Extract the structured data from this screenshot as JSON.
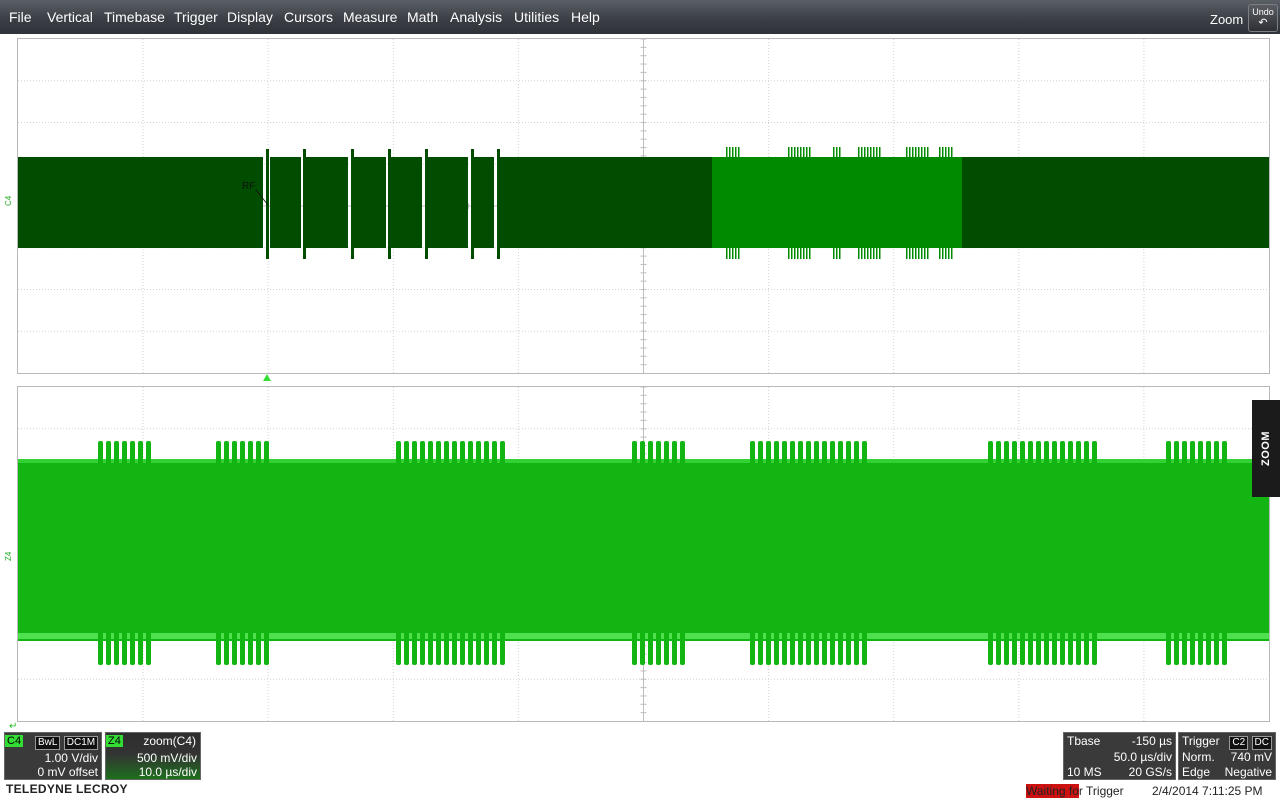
{
  "menu": {
    "items": [
      "File",
      "Vertical",
      "Timebase",
      "Trigger",
      "Display",
      "Cursors",
      "Measure",
      "Math",
      "Analysis",
      "Utilities",
      "Help"
    ],
    "zoom_label": "Zoom",
    "undo_label": "Undo"
  },
  "traces": {
    "top_label": "C4",
    "bottom_label": "Z4",
    "rf_annotation": "RF",
    "top_color": "#004d00",
    "top_highlight_color": "#008a00",
    "bottom_color": "#12b512"
  },
  "zoom_tab": {
    "label": "ZOOM"
  },
  "channel_c4": {
    "name": "C4",
    "badges": [
      "BwL",
      "DC1M"
    ],
    "volts_per_div": "1.00 V/div",
    "offset": "0 mV offset"
  },
  "channel_z4": {
    "name": "Z4",
    "source": "zoom(C4)",
    "volts_per_div": "500 mV/div",
    "time_per_div": "10.0 µs/div"
  },
  "timebase": {
    "title": "Tbase",
    "delay": "-150 µs",
    "time_per_div": "50.0 µs/div",
    "samples": "10 MS",
    "sample_rate": "20 GS/s"
  },
  "trigger": {
    "title": "Trigger",
    "source_badge": "C2",
    "coupling_badge": "DC",
    "mode": "Norm.",
    "level": "740 mV",
    "type": "Edge",
    "slope": "Negative"
  },
  "status": {
    "waiting_prefix": "Waiting fo",
    "waiting_suffix": "r Trigger",
    "timestamp": "2/4/2014 7:11:25 PM"
  },
  "brand": "TELEDYNE LECROY"
}
